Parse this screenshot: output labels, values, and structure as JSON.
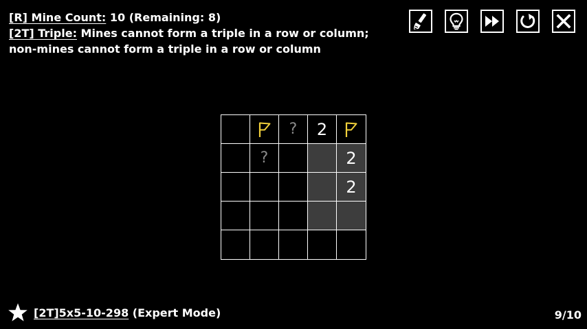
{
  "rules": {
    "line1": {
      "tag": "[R] Mine Count:",
      "text": " 10 (Remaining: 8)"
    },
    "line2": {
      "tag": "[2T] Triple:",
      "text": " Mines cannot form a triple in a row or column;"
    },
    "line3": {
      "text": "non-mines cannot form a triple in a row or column"
    }
  },
  "toolbar": {
    "buttons": [
      {
        "icon": "brush-icon"
      },
      {
        "icon": "lightbulb-icon"
      },
      {
        "icon": "fast-forward-icon"
      },
      {
        "icon": "restart-icon"
      },
      {
        "icon": "close-icon"
      }
    ]
  },
  "board": {
    "rows": 5,
    "cols": 5,
    "flag_color": "#f2d13b",
    "shaded_color": "#3d3d3d",
    "cells": [
      [
        {
          "type": "empty"
        },
        {
          "type": "flag"
        },
        {
          "type": "unknown",
          "text": "?"
        },
        {
          "type": "number",
          "text": "2"
        },
        {
          "type": "flag"
        }
      ],
      [
        {
          "type": "empty"
        },
        {
          "type": "unknown",
          "text": "?"
        },
        {
          "type": "empty"
        },
        {
          "type": "shaded"
        },
        {
          "type": "number",
          "text": "2",
          "shaded": true
        }
      ],
      [
        {
          "type": "empty"
        },
        {
          "type": "empty"
        },
        {
          "type": "empty"
        },
        {
          "type": "shaded"
        },
        {
          "type": "number",
          "text": "2",
          "shaded": true
        }
      ],
      [
        {
          "type": "empty"
        },
        {
          "type": "empty"
        },
        {
          "type": "empty"
        },
        {
          "type": "shaded"
        },
        {
          "type": "shaded"
        }
      ],
      [
        {
          "type": "empty"
        },
        {
          "type": "empty"
        },
        {
          "type": "empty"
        },
        {
          "type": "empty"
        },
        {
          "type": "empty"
        }
      ]
    ]
  },
  "footer": {
    "icon": "star-icon",
    "puzzle_code": "[2T]5x5-10-298",
    "mode": " (Expert Mode)",
    "progress": "9/10"
  }
}
